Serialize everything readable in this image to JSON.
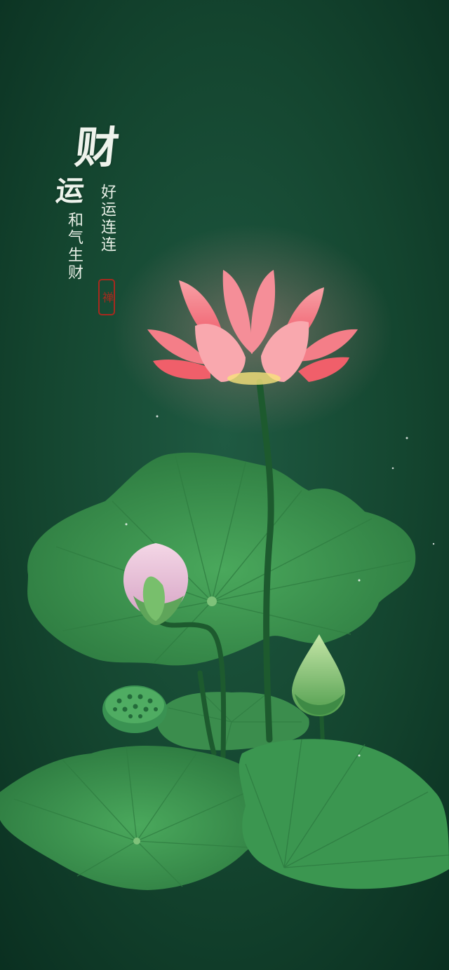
{
  "poem": {
    "main_char": "财",
    "second_char": "运",
    "line_right": "好运连连",
    "line_left": "和气生财",
    "seal": "禅"
  },
  "colors": {
    "background": "#0d3a29",
    "leaf": "#3f9a52",
    "lotus_petal": "#f26a7a",
    "text": "#eef3ec",
    "seal": "#b8261c"
  }
}
